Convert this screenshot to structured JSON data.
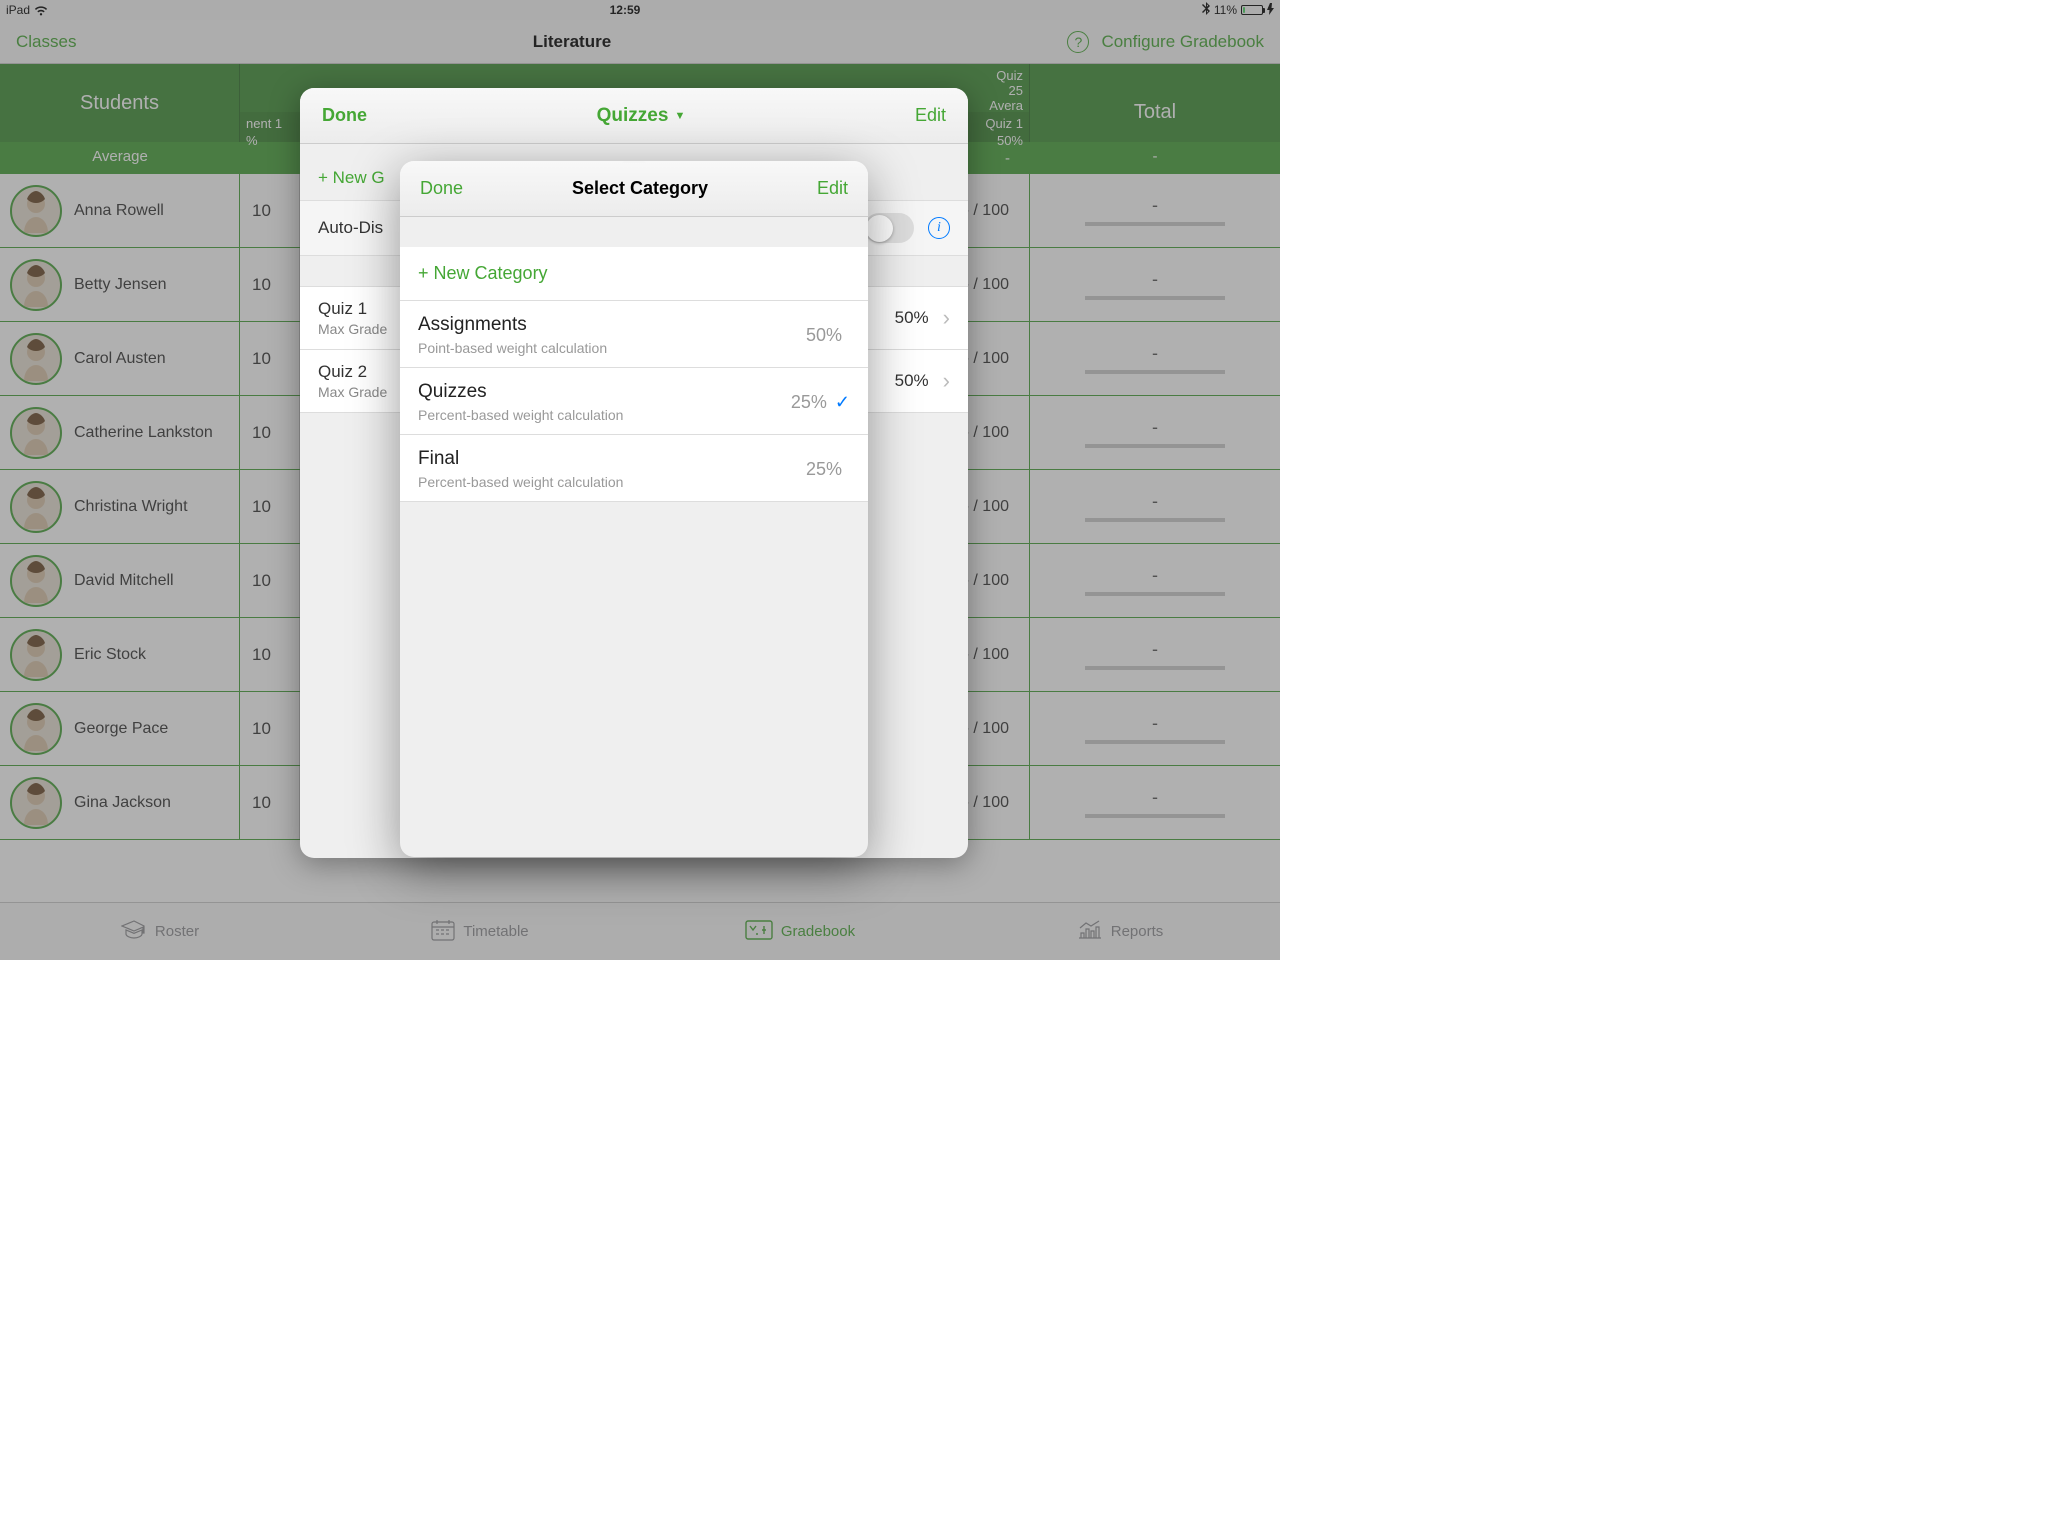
{
  "status": {
    "device": "iPad",
    "time": "12:59",
    "battery_pct": "11%"
  },
  "nav": {
    "back": "Classes",
    "title": "Literature",
    "configure": "Configure Gradebook"
  },
  "table": {
    "students_head": "Students",
    "total_head": "Total",
    "average_label": "Average",
    "assign_col_partial": "nent 1",
    "assign_pct_partial": "%",
    "quiz_header_title": "Quiz",
    "quiz_header_sub1": "25",
    "quiz_header_sub2": "Avera",
    "quiz_col_name": "Quiz 1",
    "quiz_col_sub": "50%",
    "avg_total": "-",
    "score_placeholder": "-  / 100",
    "students": [
      {
        "name": "Anna Rowell",
        "g": "10"
      },
      {
        "name": "Betty Jensen",
        "g": "10"
      },
      {
        "name": "Carol Austen",
        "g": "10"
      },
      {
        "name": "Catherine Lankston",
        "g": "10"
      },
      {
        "name": "Christina Wright",
        "g": "10"
      },
      {
        "name": "David Mitchell",
        "g": "10"
      },
      {
        "name": "Eric Stock",
        "g": "10"
      },
      {
        "name": "George Pace",
        "g": "10"
      },
      {
        "name": "Gina Jackson",
        "g": "10"
      }
    ]
  },
  "tabs": {
    "roster": "Roster",
    "timetable": "Timetable",
    "gradebook": "Gradebook",
    "reports": "Reports"
  },
  "popover_outer": {
    "done": "Done",
    "title": "Quizzes",
    "edit": "Edit",
    "new_grade_partial": "+ New G",
    "auto_dis": "Auto-Dis",
    "quiz1": "Quiz 1",
    "quiz2": "Quiz 2",
    "max_grade": "Max Grade",
    "pct50": "50%"
  },
  "popover_inner": {
    "done": "Done",
    "title": "Select Category",
    "edit": "Edit",
    "new_category": "+ New Category",
    "cats": [
      {
        "name": "Assignments",
        "desc": "Point-based weight calculation",
        "pct": "50%",
        "selected": false
      },
      {
        "name": "Quizzes",
        "desc": "Percent-based weight calculation",
        "pct": "25%",
        "selected": true
      },
      {
        "name": "Final",
        "desc": "Percent-based weight calculation",
        "pct": "25%",
        "selected": false
      }
    ]
  }
}
